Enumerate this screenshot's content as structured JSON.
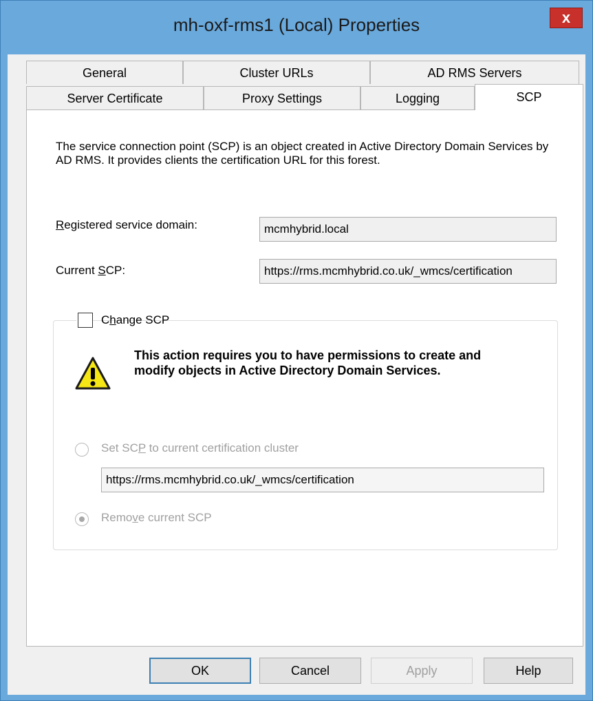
{
  "window": {
    "title": "mh-oxf-rms1 (Local) Properties",
    "close_glyph": "x"
  },
  "tabs": {
    "row1": [
      "General",
      "Cluster URLs",
      "AD RMS Servers"
    ],
    "row2": [
      "Server Certificate",
      "Proxy Settings",
      "Logging",
      "SCP"
    ],
    "active": "SCP"
  },
  "scp": {
    "description": "The service connection point (SCP) is an object created in Active Directory Domain Services by AD RMS. It provides clients the certification URL for this forest.",
    "registered_domain_label": "Registered service domain:",
    "registered_domain_value": "mcmhybrid.local",
    "current_scp_label": "Current SCP:",
    "current_scp_value": "https://rms.mcmhybrid.co.uk/_wmcs/certification",
    "change_scp_label": "Change SCP",
    "change_scp_checked": false,
    "warning": "This action requires you to have permissions to create and modify objects in Active Directory Domain Services.",
    "set_scp_label": "Set SCP to current certification cluster",
    "set_scp_url": "https://rms.mcmhybrid.co.uk/_wmcs/certification",
    "remove_scp_label": "Remove current SCP",
    "selected_option": "Remove current SCP"
  },
  "buttons": {
    "ok": "OK",
    "cancel": "Cancel",
    "apply": "Apply",
    "help": "Help"
  },
  "colors": {
    "title_bar": "#6aa9dc",
    "close_button": "#c7302b",
    "default_button_border": "#3c7fb1"
  }
}
